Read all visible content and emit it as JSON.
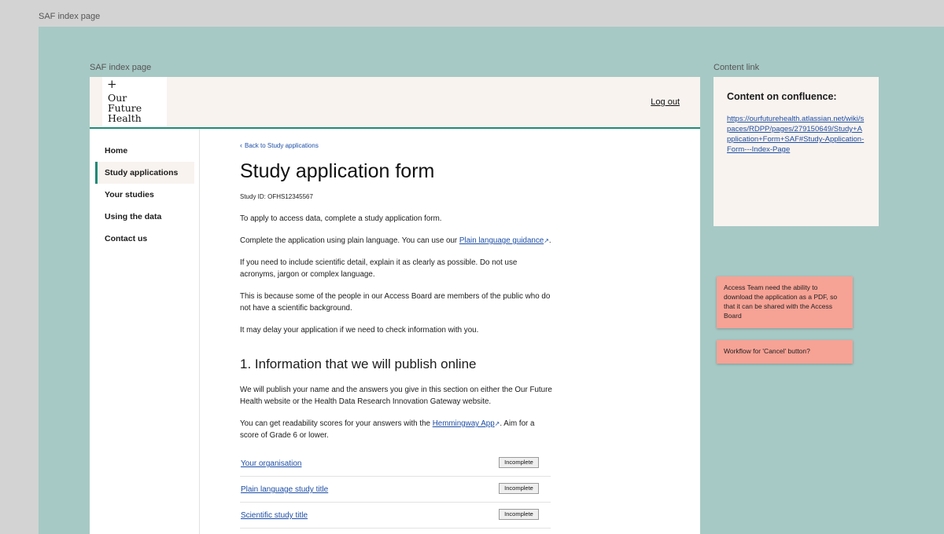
{
  "canvas": {
    "top_label": "SAF index page",
    "frame_label": "SAF index page",
    "panel_label": "Content link"
  },
  "header": {
    "logo_plus": "+",
    "logo_lines": [
      "Our",
      "Future",
      "Health"
    ],
    "logout": "Log out"
  },
  "sidebar": {
    "items": [
      {
        "label": "Home",
        "active": false
      },
      {
        "label": "Study applications",
        "active": true
      },
      {
        "label": "Your studies",
        "active": false
      },
      {
        "label": "Using the data",
        "active": false
      },
      {
        "label": "Contact us",
        "active": false
      }
    ]
  },
  "main": {
    "back_link": "Back to Study applications",
    "title": "Study application form",
    "study_id": "Study ID: OFHS12345567",
    "p1": "To apply to access data, complete a study application form.",
    "p2_before": "Complete the application using plain language. You can use our ",
    "p2_link": "Plain language guidance",
    "p2_after": ".",
    "p3": "If you need to include scientific detail, explain it as clearly as possible. Do not use acronyms, jargon or complex language.",
    "p4": "This is because some of the people in our Access Board are members of the public who do not have a scientific background.",
    "p5": "It may delay your application if we need to check information with you.",
    "section_title": "1. Information that we will publish online",
    "p6": "We will publish your name and the answers you give in this section on either the Our Future Health website or the Health Data Research Innovation Gateway website.",
    "p7_before": "You can get readability scores for your answers with the ",
    "p7_link": "Hemmingway App",
    "p7_after": ". Aim for a score of Grade 6 or lower.",
    "tasks": [
      {
        "label": "Your organisation",
        "status": "Incomplete"
      },
      {
        "label": "Plain language study title",
        "status": "Incomplete"
      },
      {
        "label": "Scientific study title",
        "status": "Incomplete"
      }
    ]
  },
  "panel": {
    "title": "Content on confluence:",
    "url": "https://ourfuturehealth.atlassian.net/wiki/spaces/RDPP/pages/279150649/Study+Application+Form+SAF#Study-Application-Form---Index-Page"
  },
  "notes": [
    "Access Team need the ability to download the application as a PDF, so that it can be shared with the Access Board",
    "Workflow for 'Cancel' button?"
  ],
  "icons": {
    "back": "chevron-left-icon",
    "external": "external-link-icon"
  }
}
